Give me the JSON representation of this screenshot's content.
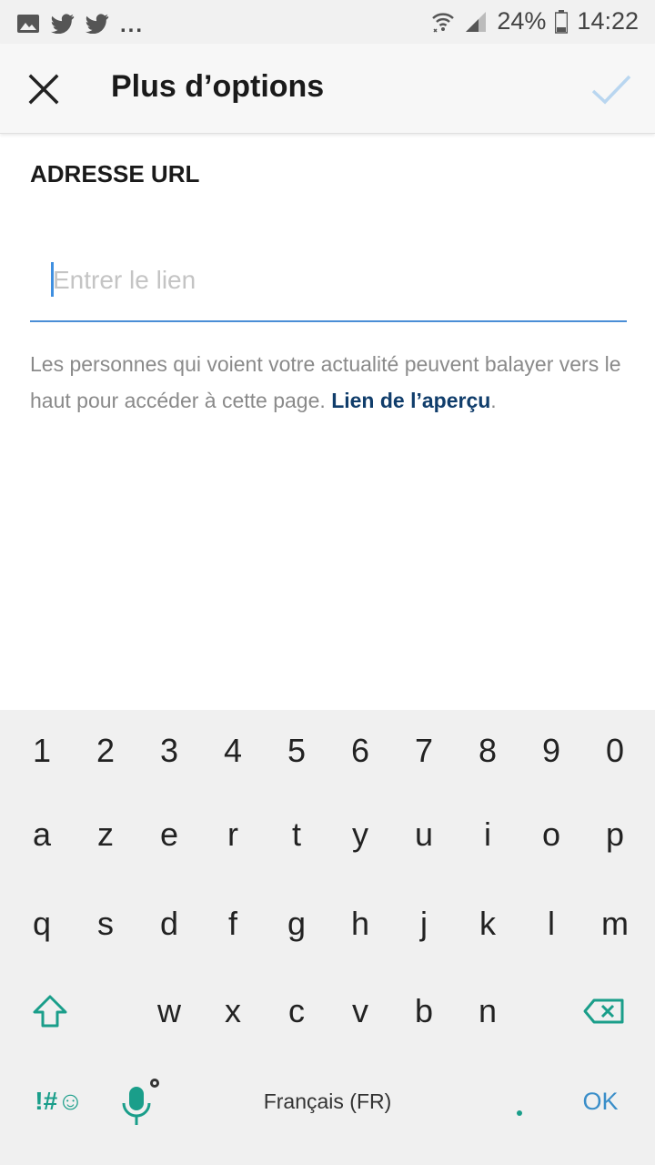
{
  "status_bar": {
    "left_icons": [
      "gallery-icon",
      "twitter-icon",
      "twitter-icon"
    ],
    "overflow": "...",
    "battery_percent": "24%",
    "time": "14:22"
  },
  "header": {
    "title": "Plus d’options"
  },
  "form": {
    "section_label": "ADRESSE URL",
    "url_placeholder": "Entrer le lien",
    "url_value": "",
    "help_text": "Les personnes qui voient votre actualité peuvent balayer vers le haut pour accéder à cette page.",
    "help_link": "Lien de l’aperçu",
    "help_period": "."
  },
  "keyboard": {
    "row_numbers": [
      "1",
      "2",
      "3",
      "4",
      "5",
      "6",
      "7",
      "8",
      "9",
      "0"
    ],
    "row1": [
      "a",
      "z",
      "e",
      "r",
      "t",
      "y",
      "u",
      "i",
      "o",
      "p"
    ],
    "row2": [
      "q",
      "s",
      "d",
      "f",
      "g",
      "h",
      "j",
      "k",
      "l",
      "m"
    ],
    "row3": [
      "w",
      "x",
      "c",
      "v",
      "b",
      "n"
    ],
    "symbols_label": "!#☺",
    "space_label": "Français (FR)",
    "ok_label": "OK"
  },
  "colors": {
    "accent_blue": "#4a8ed6",
    "link": "#103d6b",
    "keyboard_teal": "#1a9e8a",
    "check_disabled": "#b9d6f0"
  }
}
